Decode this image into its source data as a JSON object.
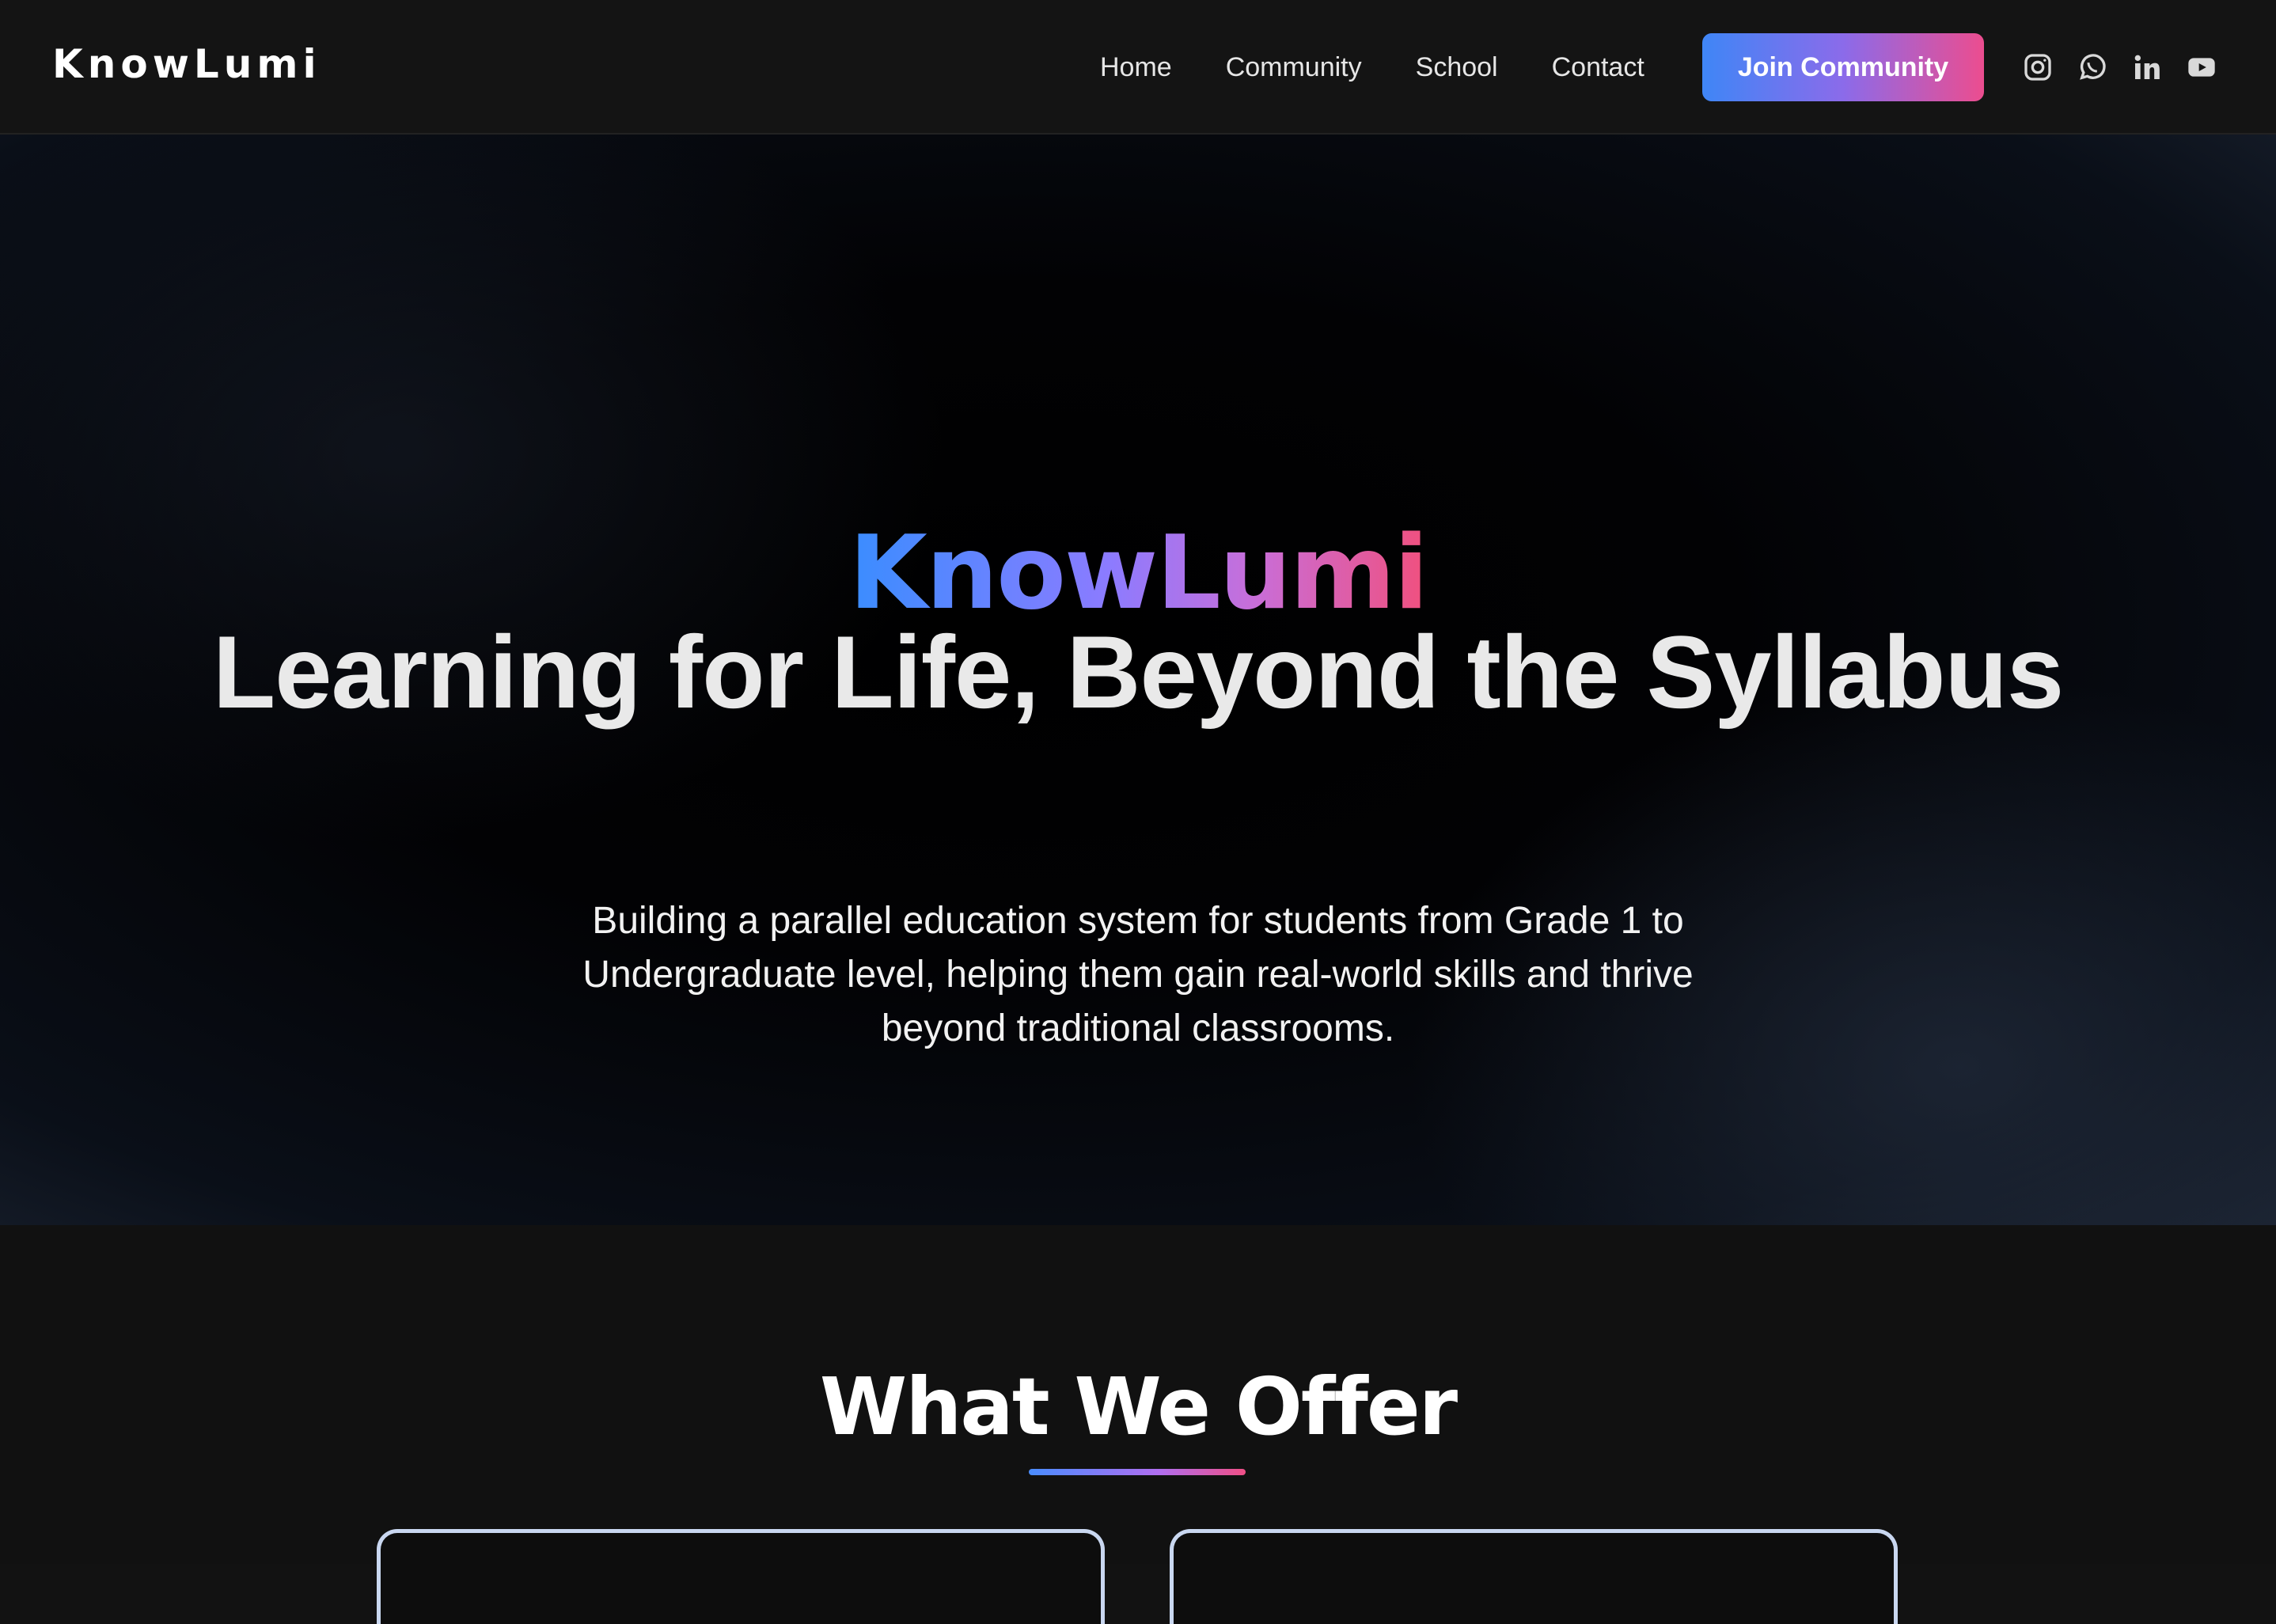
{
  "header": {
    "logo": "KnowLumi",
    "nav": [
      {
        "label": "Home"
      },
      {
        "label": "Community"
      },
      {
        "label": "School"
      },
      {
        "label": "Contact"
      }
    ],
    "cta_label": "Join Community",
    "social_icons": [
      "instagram-icon",
      "whatsapp-icon",
      "linkedin-icon",
      "youtube-icon"
    ]
  },
  "hero": {
    "brand": "KnowLumi",
    "title": "Learning for Life, Beyond the Syllabus",
    "subtitle": "Building a parallel education system for students from Grade 1 to Undergraduate level, helping them gain real-world skills and thrive beyond traditional classrooms."
  },
  "offer": {
    "title": "What We Offer"
  },
  "colors": {
    "gradient_start": "#3f86f6",
    "gradient_mid": "#8b6bea",
    "gradient_end": "#ec4d8f",
    "background": "#121212"
  }
}
